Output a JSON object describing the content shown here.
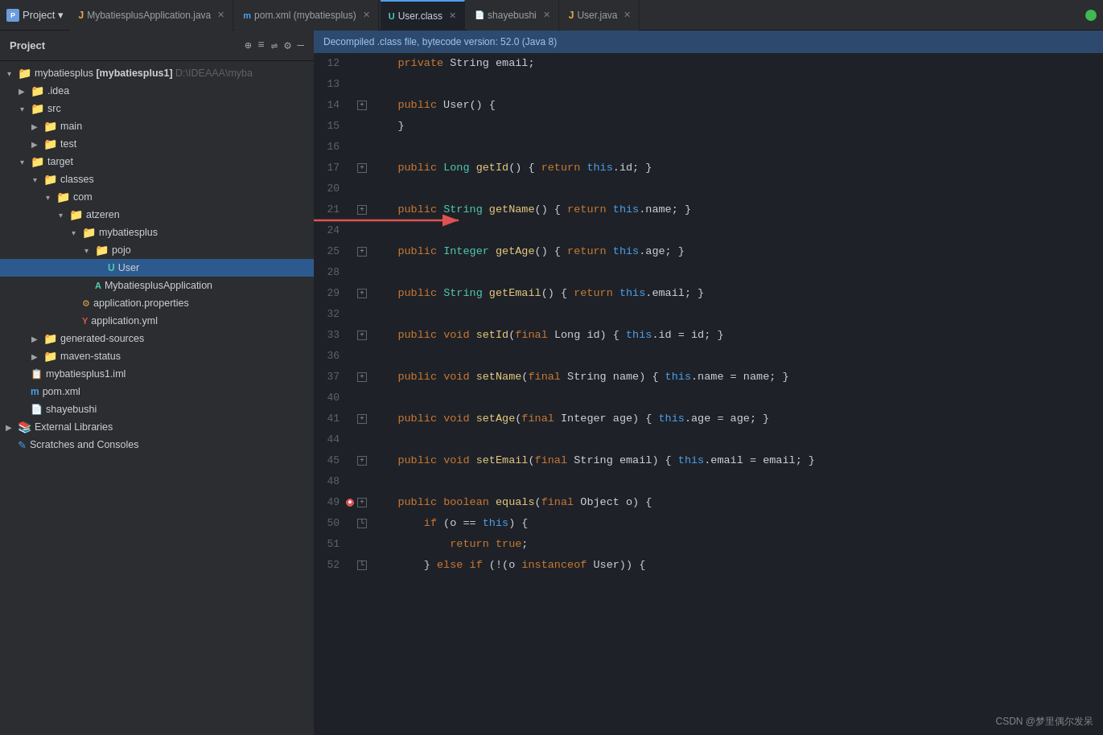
{
  "titlebar": {
    "project_label": "Project",
    "dropdown_icon": "▾",
    "toolbar_icons": [
      "⊕",
      "≡",
      "⇌",
      "⚙",
      "—"
    ],
    "tabs": [
      {
        "id": "mybatiesplus-java",
        "label": "MybatiesplusApplication.java",
        "type": "java",
        "active": false
      },
      {
        "id": "pom-xml",
        "label": "pom.xml (mybatiesplus)",
        "type": "xml",
        "active": false
      },
      {
        "id": "user-class",
        "label": "User.class",
        "type": "class",
        "active": true
      },
      {
        "id": "shayebushi",
        "label": "shayebushi",
        "type": "file",
        "active": false
      },
      {
        "id": "user-java",
        "label": "User.java",
        "type": "java",
        "active": false
      }
    ]
  },
  "sidebar": {
    "title": "Project",
    "tree": [
      {
        "id": "mybatiesplus-root",
        "indent": 0,
        "arrow": "▾",
        "icon": "📁",
        "icon_type": "folder-orange",
        "label": "mybatiesplus [mybatiesplus1]",
        "suffix": " D:\\IDEAAA\\myba"
      },
      {
        "id": "idea",
        "indent": 1,
        "arrow": "▶",
        "icon": "📁",
        "icon_type": "folder",
        "label": ".idea"
      },
      {
        "id": "src",
        "indent": 1,
        "arrow": "▾",
        "icon": "📁",
        "icon_type": "folder",
        "label": "src"
      },
      {
        "id": "main",
        "indent": 2,
        "arrow": "▶",
        "icon": "📁",
        "icon_type": "folder",
        "label": "main"
      },
      {
        "id": "test",
        "indent": 2,
        "arrow": "▶",
        "icon": "📁",
        "icon_type": "folder",
        "label": "test"
      },
      {
        "id": "target",
        "indent": 1,
        "arrow": "▾",
        "icon": "📁",
        "icon_type": "folder-orange",
        "label": "target"
      },
      {
        "id": "classes",
        "indent": 2,
        "arrow": "▾",
        "icon": "📁",
        "icon_type": "folder",
        "label": "classes"
      },
      {
        "id": "com",
        "indent": 3,
        "arrow": "▾",
        "icon": "📁",
        "icon_type": "folder",
        "label": "com"
      },
      {
        "id": "atzeren",
        "indent": 4,
        "arrow": "▾",
        "icon": "📁",
        "icon_type": "folder",
        "label": "atzeren"
      },
      {
        "id": "mybatiesplus-pkg",
        "indent": 5,
        "arrow": "▾",
        "icon": "📁",
        "icon_type": "folder",
        "label": "mybatiesplus"
      },
      {
        "id": "pojo",
        "indent": 6,
        "arrow": "▾",
        "icon": "📁",
        "icon_type": "folder",
        "label": "pojo"
      },
      {
        "id": "user-class-file",
        "indent": 7,
        "arrow": "",
        "icon": "U",
        "icon_type": "class",
        "label": "User",
        "selected": true
      },
      {
        "id": "mybatiesplus-app",
        "indent": 6,
        "arrow": "",
        "icon": "A",
        "icon_type": "app",
        "label": "MybatiesplusApplication"
      },
      {
        "id": "app-properties",
        "indent": 5,
        "arrow": "",
        "icon": "P",
        "icon_type": "properties",
        "label": "application.properties"
      },
      {
        "id": "app-yml",
        "indent": 5,
        "arrow": "",
        "icon": "Y",
        "icon_type": "yml",
        "label": "application.yml"
      },
      {
        "id": "generated-sources",
        "indent": 2,
        "arrow": "▶",
        "icon": "📁",
        "icon_type": "folder",
        "label": "generated-sources"
      },
      {
        "id": "maven-status",
        "indent": 2,
        "arrow": "▶",
        "icon": "📁",
        "icon_type": "folder-orange",
        "label": "maven-status"
      },
      {
        "id": "mybatiesplus1-iml",
        "indent": 1,
        "arrow": "",
        "icon": "M",
        "icon_type": "iml",
        "label": "mybatiesplus1.iml"
      },
      {
        "id": "pom-xml-file",
        "indent": 1,
        "arrow": "",
        "icon": "m",
        "icon_type": "xml-blue",
        "label": "pom.xml"
      },
      {
        "id": "shayebushi-file",
        "indent": 1,
        "arrow": "",
        "icon": "S",
        "icon_type": "shaye",
        "label": "shayebushi"
      },
      {
        "id": "ext-libs",
        "indent": 0,
        "arrow": "▶",
        "icon": "📚",
        "icon_type": "libs",
        "label": "External Libraries"
      },
      {
        "id": "scratches",
        "indent": 0,
        "arrow": "",
        "icon": "✎",
        "icon_type": "scratch",
        "label": "Scratches and Consoles"
      }
    ]
  },
  "decompile_notice": "Decompiled .class file, bytecode version: 52.0 (Java 8)",
  "code": {
    "lines": [
      {
        "num": 12,
        "gutter": "",
        "tokens": [
          {
            "t": "    ",
            "c": ""
          },
          {
            "t": "private",
            "c": "kw"
          },
          {
            "t": " String ",
            "c": ""
          },
          {
            "t": "email",
            "c": ""
          },
          {
            "t": ";",
            "c": ""
          }
        ]
      },
      {
        "num": 13,
        "gutter": "",
        "tokens": []
      },
      {
        "num": 14,
        "gutter": "fold",
        "tokens": [
          {
            "t": "    ",
            "c": ""
          },
          {
            "t": "public",
            "c": "kw"
          },
          {
            "t": " ",
            "c": ""
          },
          {
            "t": "User",
            "c": ""
          },
          {
            "t": "() {",
            "c": ""
          }
        ]
      },
      {
        "num": 15,
        "gutter": "foldend",
        "tokens": [
          {
            "t": "    }",
            "c": ""
          }
        ]
      },
      {
        "num": 16,
        "gutter": "",
        "tokens": []
      },
      {
        "num": 17,
        "gutter": "expand",
        "tokens": [
          {
            "t": "    ",
            "c": ""
          },
          {
            "t": "public",
            "c": "kw"
          },
          {
            "t": " ",
            "c": ""
          },
          {
            "t": "Long",
            "c": "rettype"
          },
          {
            "t": " ",
            "c": ""
          },
          {
            "t": "getId",
            "c": "method"
          },
          {
            "t": "() { ",
            "c": ""
          },
          {
            "t": "return",
            "c": "kw"
          },
          {
            "t": " ",
            "c": ""
          },
          {
            "t": "this",
            "c": "this"
          },
          {
            "t": ".id; }",
            "c": ""
          }
        ]
      },
      {
        "num": 20,
        "gutter": "",
        "tokens": []
      },
      {
        "num": 21,
        "gutter": "expand",
        "tokens": [
          {
            "t": "    ",
            "c": ""
          },
          {
            "t": "public",
            "c": "kw"
          },
          {
            "t": " ",
            "c": ""
          },
          {
            "t": "String",
            "c": "rettype"
          },
          {
            "t": " ",
            "c": ""
          },
          {
            "t": "getName",
            "c": "method"
          },
          {
            "t": "() { ",
            "c": ""
          },
          {
            "t": "return",
            "c": "kw"
          },
          {
            "t": " ",
            "c": ""
          },
          {
            "t": "this",
            "c": "this"
          },
          {
            "t": ".name; }",
            "c": ""
          }
        ]
      },
      {
        "num": 24,
        "gutter": "",
        "tokens": [],
        "arrow": true
      },
      {
        "num": 25,
        "gutter": "expand",
        "tokens": [
          {
            "t": "    ",
            "c": ""
          },
          {
            "t": "public",
            "c": "kw"
          },
          {
            "t": " ",
            "c": ""
          },
          {
            "t": "Integer",
            "c": "rettype"
          },
          {
            "t": " ",
            "c": ""
          },
          {
            "t": "getAge",
            "c": "method"
          },
          {
            "t": "() { ",
            "c": ""
          },
          {
            "t": "return",
            "c": "kw"
          },
          {
            "t": " ",
            "c": ""
          },
          {
            "t": "this",
            "c": "this"
          },
          {
            "t": ".age; }",
            "c": ""
          }
        ]
      },
      {
        "num": 28,
        "gutter": "",
        "tokens": []
      },
      {
        "num": 29,
        "gutter": "expand",
        "tokens": [
          {
            "t": "    ",
            "c": ""
          },
          {
            "t": "public",
            "c": "kw"
          },
          {
            "t": " ",
            "c": ""
          },
          {
            "t": "String",
            "c": "rettype"
          },
          {
            "t": " ",
            "c": ""
          },
          {
            "t": "getEmail",
            "c": "method"
          },
          {
            "t": "() { ",
            "c": ""
          },
          {
            "t": "return",
            "c": "kw"
          },
          {
            "t": " ",
            "c": ""
          },
          {
            "t": "this",
            "c": "this"
          },
          {
            "t": ".email; }",
            "c": ""
          }
        ]
      },
      {
        "num": 32,
        "gutter": "",
        "tokens": []
      },
      {
        "num": 33,
        "gutter": "expand",
        "tokens": [
          {
            "t": "    ",
            "c": ""
          },
          {
            "t": "public",
            "c": "kw"
          },
          {
            "t": " ",
            "c": ""
          },
          {
            "t": "void",
            "c": "kw"
          },
          {
            "t": " ",
            "c": ""
          },
          {
            "t": "setId",
            "c": "method"
          },
          {
            "t": "(",
            "c": ""
          },
          {
            "t": "final",
            "c": "kw"
          },
          {
            "t": " Long id) { ",
            "c": ""
          },
          {
            "t": "this",
            "c": "this"
          },
          {
            "t": ".id = id; }",
            "c": ""
          }
        ]
      },
      {
        "num": 36,
        "gutter": "",
        "tokens": []
      },
      {
        "num": 37,
        "gutter": "expand",
        "tokens": [
          {
            "t": "    ",
            "c": ""
          },
          {
            "t": "public",
            "c": "kw"
          },
          {
            "t": " ",
            "c": ""
          },
          {
            "t": "void",
            "c": "kw"
          },
          {
            "t": " ",
            "c": ""
          },
          {
            "t": "setName",
            "c": "method"
          },
          {
            "t": "(",
            "c": ""
          },
          {
            "t": "final",
            "c": "kw"
          },
          {
            "t": " String name) { ",
            "c": ""
          },
          {
            "t": "this",
            "c": "this"
          },
          {
            "t": ".name = name; }",
            "c": ""
          }
        ]
      },
      {
        "num": 40,
        "gutter": "",
        "tokens": []
      },
      {
        "num": 41,
        "gutter": "expand",
        "tokens": [
          {
            "t": "    ",
            "c": ""
          },
          {
            "t": "public",
            "c": "kw"
          },
          {
            "t": " ",
            "c": ""
          },
          {
            "t": "void",
            "c": "kw"
          },
          {
            "t": " ",
            "c": ""
          },
          {
            "t": "setAge",
            "c": "method"
          },
          {
            "t": "(",
            "c": ""
          },
          {
            "t": "final",
            "c": "kw"
          },
          {
            "t": " Integer age) { ",
            "c": ""
          },
          {
            "t": "this",
            "c": "this"
          },
          {
            "t": ".age = age; }",
            "c": ""
          }
        ]
      },
      {
        "num": 44,
        "gutter": "",
        "tokens": []
      },
      {
        "num": 45,
        "gutter": "expand",
        "tokens": [
          {
            "t": "    ",
            "c": ""
          },
          {
            "t": "public",
            "c": "kw"
          },
          {
            "t": " ",
            "c": ""
          },
          {
            "t": "void",
            "c": "kw"
          },
          {
            "t": " ",
            "c": ""
          },
          {
            "t": "setEmail",
            "c": "method"
          },
          {
            "t": "(",
            "c": ""
          },
          {
            "t": "final",
            "c": "kw"
          },
          {
            "t": " String email) { ",
            "c": ""
          },
          {
            "t": "this",
            "c": "this"
          },
          {
            "t": ".email = email; }",
            "c": ""
          }
        ]
      },
      {
        "num": 48,
        "gutter": "",
        "tokens": []
      },
      {
        "num": 49,
        "gutter": "run",
        "tokens": [
          {
            "t": "    ",
            "c": ""
          },
          {
            "t": "public",
            "c": "kw"
          },
          {
            "t": " ",
            "c": ""
          },
          {
            "t": "boolean",
            "c": "kw"
          },
          {
            "t": " ",
            "c": ""
          },
          {
            "t": "equals",
            "c": "method"
          },
          {
            "t": "(",
            "c": ""
          },
          {
            "t": "final",
            "c": "kw"
          },
          {
            "t": " Object o) {",
            "c": ""
          }
        ]
      },
      {
        "num": 50,
        "gutter": "foldend",
        "tokens": [
          {
            "t": "        ",
            "c": ""
          },
          {
            "t": "if",
            "c": "kw"
          },
          {
            "t": " (o == ",
            "c": ""
          },
          {
            "t": "this",
            "c": "this"
          },
          {
            "t": ") {",
            "c": ""
          }
        ]
      },
      {
        "num": 51,
        "gutter": "",
        "tokens": [
          {
            "t": "            ",
            "c": ""
          },
          {
            "t": "return",
            "c": "kw"
          },
          {
            "t": " ",
            "c": ""
          },
          {
            "t": "true",
            "c": "kw"
          },
          {
            "t": ";",
            "c": ""
          }
        ]
      },
      {
        "num": 52,
        "gutter": "foldend2",
        "tokens": [
          {
            "t": "        } ",
            "c": ""
          },
          {
            "t": "else",
            "c": "kw"
          },
          {
            "t": " ",
            "c": ""
          },
          {
            "t": "if",
            "c": "kw"
          },
          {
            "t": " (!(o ",
            "c": ""
          },
          {
            "t": "instanceof",
            "c": "kw"
          },
          {
            "t": " User)) {",
            "c": ""
          }
        ]
      }
    ]
  },
  "watermark": "CSDN @梦里偶尔发呆"
}
